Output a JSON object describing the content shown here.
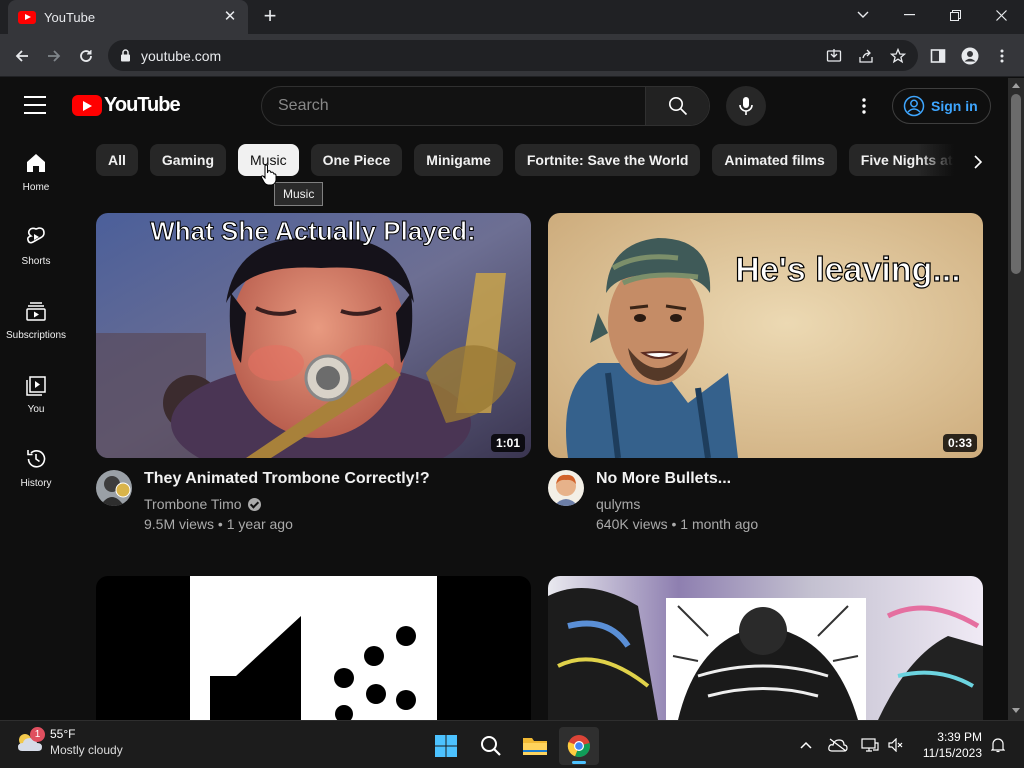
{
  "browser": {
    "tab_title": "YouTube",
    "url": "youtube.com"
  },
  "masthead": {
    "logo_text": "YouTube",
    "search_placeholder": "Search",
    "signin_label": "Sign in"
  },
  "sidebar": {
    "items": [
      {
        "label": "Home",
        "icon": "home-icon"
      },
      {
        "label": "Shorts",
        "icon": "shorts-icon"
      },
      {
        "label": "Subscriptions",
        "icon": "subscriptions-icon"
      },
      {
        "label": "You",
        "icon": "you-icon"
      },
      {
        "label": "History",
        "icon": "history-icon"
      }
    ]
  },
  "chips": {
    "items": [
      "All",
      "Gaming",
      "Music",
      "One Piece",
      "Minigame",
      "Fortnite: Save the World",
      "Animated films",
      "Five Nights at Fr"
    ],
    "active": "Music",
    "tooltip": "Music"
  },
  "videos": [
    {
      "thumb_caption": "What She Actually Played:",
      "duration": "1:01",
      "title": "They Animated Trombone Correctly!?",
      "channel": "Trombone Timo",
      "verified": true,
      "stats": "9.5M views • 1 year ago"
    },
    {
      "thumb_caption": "He's leaving...",
      "duration": "0:33",
      "title": "No More Bullets...",
      "channel": "qulyms",
      "verified": false,
      "stats": "640K views • 1 month ago"
    }
  ],
  "taskbar": {
    "weather_badge": "1",
    "temperature": "55°F",
    "condition": "Mostly cloudy",
    "time": "3:39 PM",
    "date": "11/15/2023"
  },
  "colors": {
    "background": "#0f0f0f",
    "brand_red": "#ff0000",
    "link_blue": "#3ea6ff",
    "chip_bg": "#272727"
  }
}
